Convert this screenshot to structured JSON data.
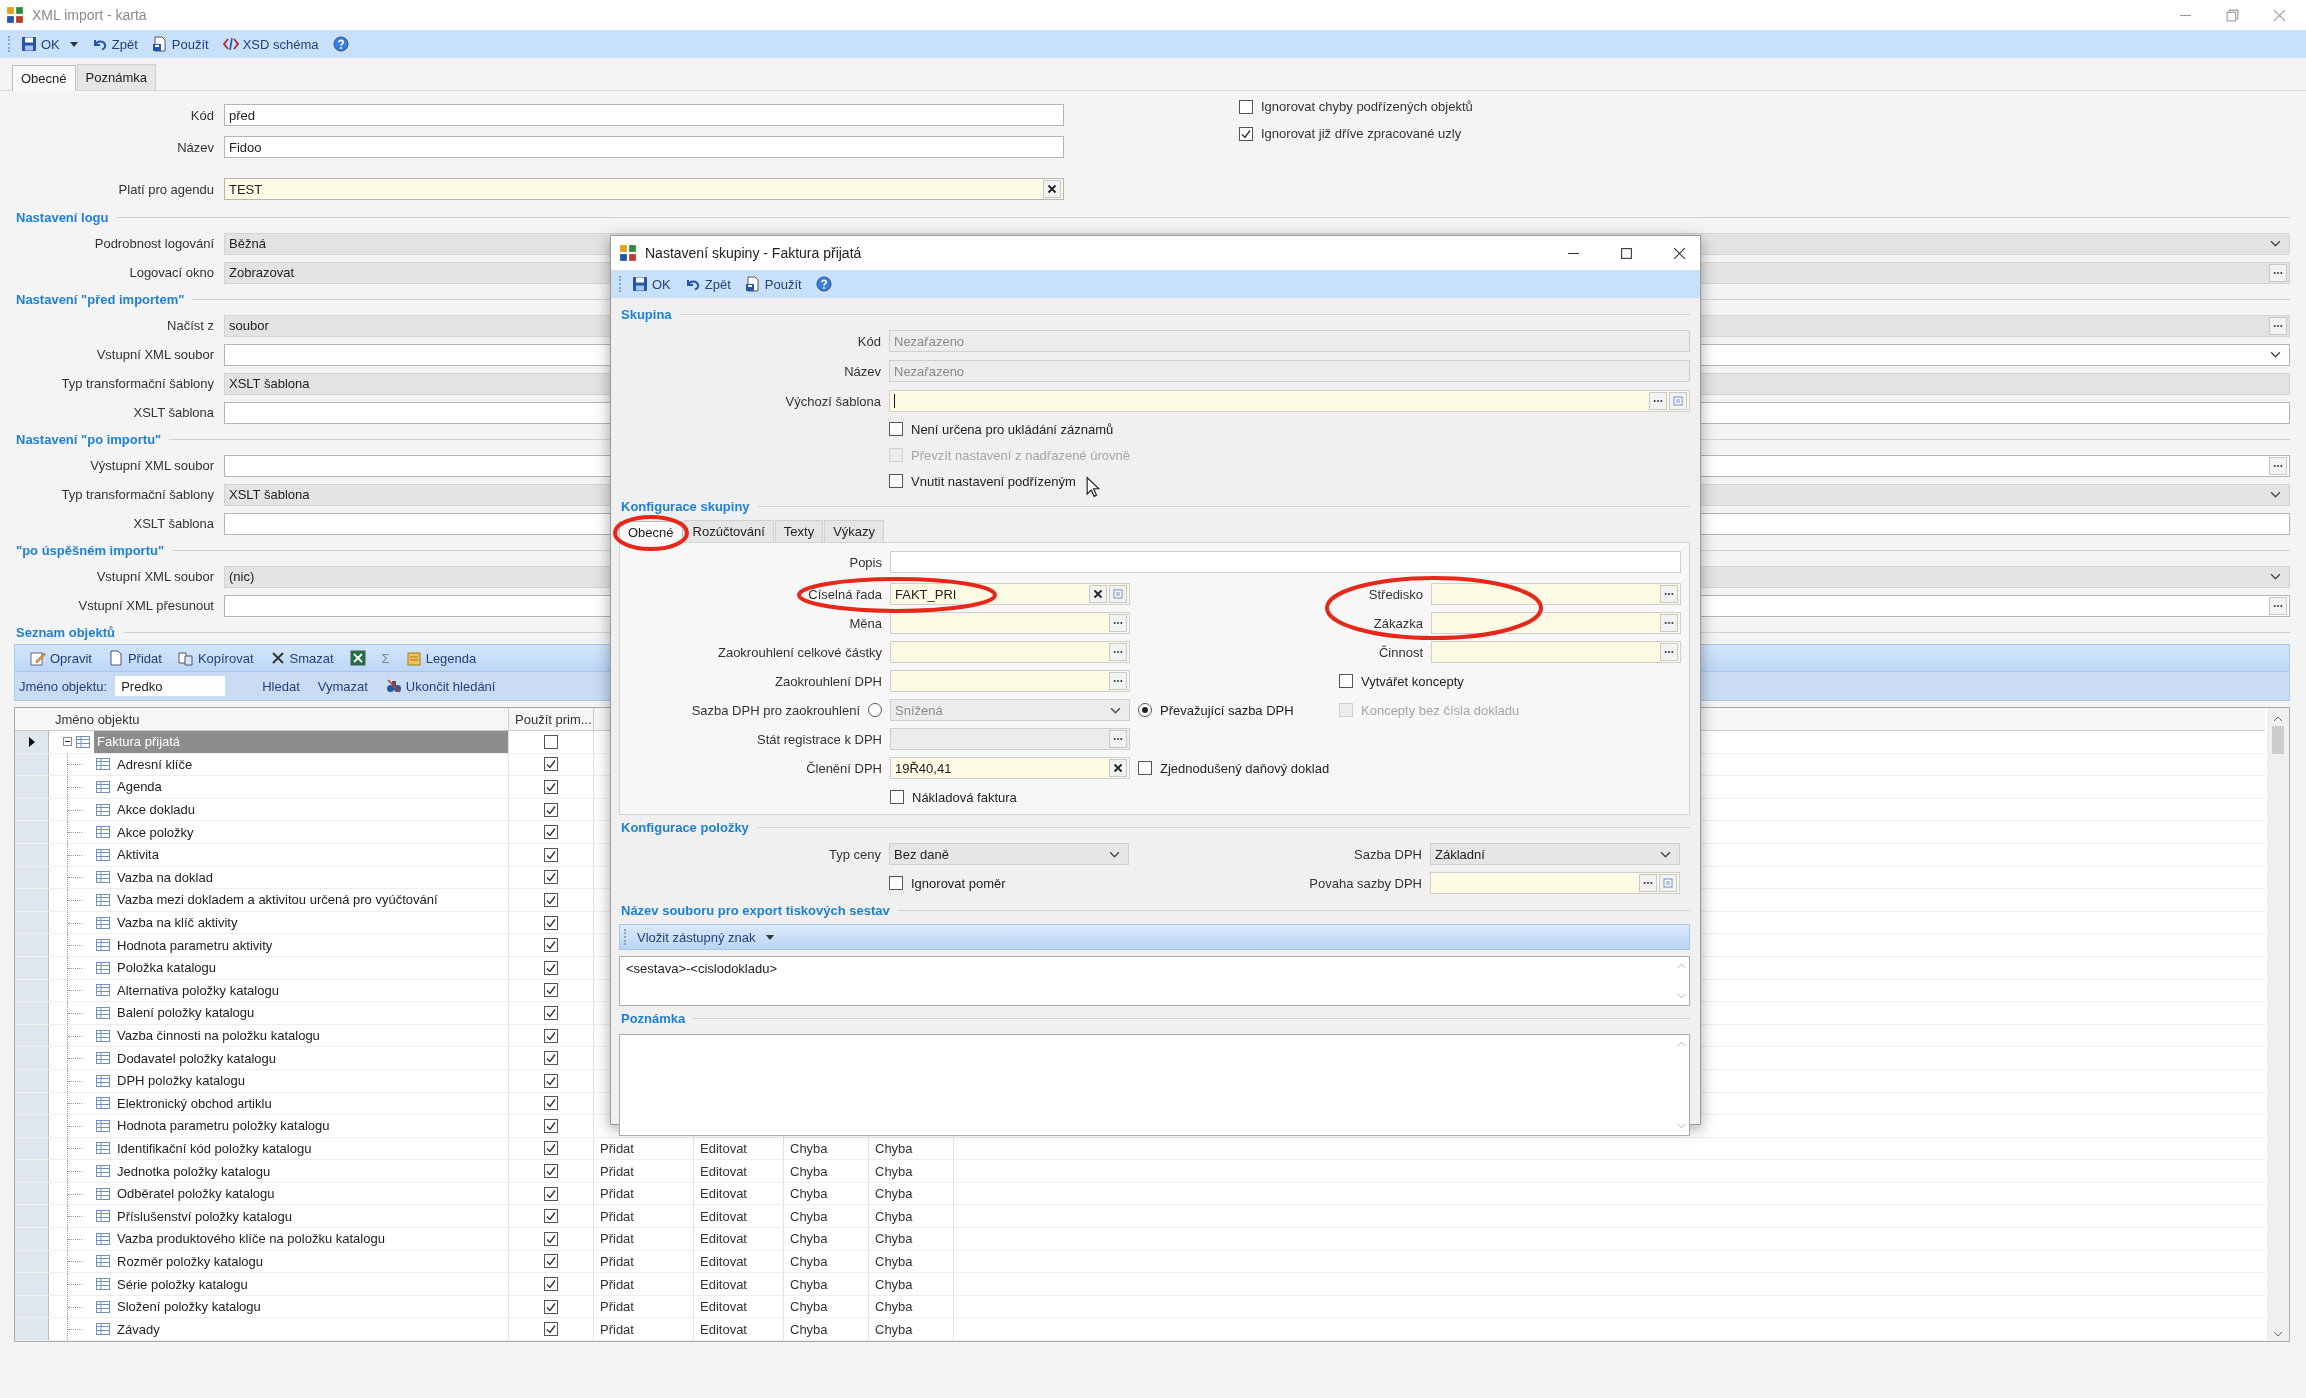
{
  "window": {
    "title": "XML import - karta"
  },
  "toolbar": [
    {
      "kind": "save",
      "label": "OK",
      "menu": true
    },
    {
      "kind": "undo",
      "label": "Zpět"
    },
    {
      "kind": "apply",
      "label": "Použít"
    },
    {
      "kind": "schema",
      "label": "XSD schéma"
    },
    {
      "kind": "help"
    }
  ],
  "tabs": [
    {
      "label": "Obecné",
      "selected": true
    },
    {
      "label": "Poznámka",
      "selected": false
    }
  ],
  "header_fields": [
    {
      "label": "Kód",
      "value": "před",
      "kind": "text"
    },
    {
      "label": "Název",
      "value": "Fidoo",
      "kind": "text"
    },
    {
      "label": "Platí pro agendu",
      "value": "TEST",
      "kind": "lookup"
    }
  ],
  "options": [
    {
      "label": "Ignorovat chyby podřízených objektů",
      "checked": false
    },
    {
      "label": "Ignorovat již dříve zpracované uzly",
      "checked": true
    }
  ],
  "sections": [
    {
      "title": "Nastavení logu",
      "rows": [
        {
          "label": "Podrobnost logování",
          "value": "Běžná",
          "kind": "select",
          "dropdown": true
        },
        {
          "label": "Logovací okno",
          "value": "Zobrazovat",
          "kind": "select",
          "browse": true
        }
      ]
    },
    {
      "title": "Nastavení \"před importem\"",
      "rows": [
        {
          "label": "Načíst z",
          "value": "soubor",
          "kind": "select",
          "browse": true
        },
        {
          "label": "Vstupní XML soubor",
          "kind": "text",
          "dropdown": true
        },
        {
          "label": "Typ transformační šablony",
          "value": "XSLT šablona",
          "kind": "select"
        },
        {
          "label": "XSLT šablona",
          "kind": "text"
        }
      ]
    },
    {
      "title": "Nastavení \"po importu\"",
      "rows": [
        {
          "label": "Výstupní XML soubor",
          "kind": "text",
          "browse": true
        },
        {
          "label": "Typ transformační šablony",
          "value": "XSLT šablona",
          "kind": "select",
          "dropdown": true
        },
        {
          "label": "XSLT šablona",
          "kind": "text"
        }
      ]
    },
    {
      "title": "\"po úspěšném importu\"",
      "rows": [
        {
          "label": "Vstupní XML soubor",
          "value": "(nic)",
          "kind": "select",
          "dropdown": true
        },
        {
          "label": "Vstupní XML přesunout",
          "kind": "text",
          "browse": true
        }
      ]
    }
  ],
  "objects": {
    "title": "Seznam objektů",
    "toolbar": [
      {
        "kind": "edit",
        "label": "Opravit"
      },
      {
        "kind": "new",
        "label": "Přidat"
      },
      {
        "kind": "copy",
        "label": "Kopírovat"
      },
      {
        "kind": "delete",
        "label": "Smazat"
      },
      {
        "kind": "excel"
      },
      {
        "kind": "sum",
        "label": "Σ"
      },
      {
        "kind": "legend",
        "label": "Legenda"
      }
    ],
    "search": {
      "label": "Jméno objektu:",
      "value": "Predko",
      "actions": [
        {
          "label": "Hledat"
        },
        {
          "label": "Vymazat"
        },
        {
          "label": "Ukončit hledání",
          "icon": true
        }
      ]
    },
    "table": {
      "columns": [
        "Jméno objektu",
        "Použít prim..."
      ],
      "rows": [
        {
          "name": "Faktura přijatá",
          "used": false,
          "selected": true,
          "expanded": true,
          "children": [
            {
              "name": "Adresní klíče",
              "used": true,
              "selected": false
            },
            {
              "name": "Agenda",
              "used": true,
              "selected": false
            },
            {
              "name": "Akce dokladu",
              "used": true,
              "selected": false
            },
            {
              "name": "Akce položky",
              "used": true,
              "selected": false
            },
            {
              "name": "Aktivita",
              "used": true,
              "selected": false
            },
            {
              "name": "Vazba na doklad",
              "used": true,
              "selected": false
            },
            {
              "name": "Vazba mezi dokladem a aktivitou určená pro vyúčtování",
              "used": true,
              "selected": false
            },
            {
              "name": "Vazba na klíč aktivity",
              "used": true,
              "selected": false
            },
            {
              "name": "Hodnota parametru aktivity",
              "used": true,
              "selected": false
            },
            {
              "name": "Položka katalogu",
              "used": true,
              "selected": false
            },
            {
              "name": "Alternativa položky katalogu",
              "used": true,
              "selected": false
            },
            {
              "name": "Balení položky katalogu",
              "used": true,
              "selected": false
            },
            {
              "name": "Vazba činnosti na položku katalogu",
              "used": true,
              "selected": false
            },
            {
              "name": "Dodavatel položky katalogu",
              "used": true,
              "selected": false
            },
            {
              "name": "DPH položky katalogu",
              "used": true,
              "selected": false
            },
            {
              "name": "Elektronický obchod artiklu",
              "used": true,
              "selected": false
            },
            {
              "name": "Hodnota parametru položky katalogu",
              "used": true,
              "selected": false
            },
            {
              "name": "Identifikační kód položky katalogu",
              "used": true,
              "selected": false,
              "cells": [
                "Přidat",
                "Editovat",
                "Chyba",
                "Chyba"
              ]
            },
            {
              "name": "Jednotka položky katalogu",
              "used": true,
              "selected": false,
              "cells": [
                "Přidat",
                "Editovat",
                "Chyba",
                "Chyba"
              ]
            },
            {
              "name": "Odběratel položky katalogu",
              "used": true,
              "selected": false,
              "cells": [
                "Přidat",
                "Editovat",
                "Chyba",
                "Chyba"
              ]
            },
            {
              "name": "Příslušenství položky katalogu",
              "used": true,
              "selected": false,
              "cells": [
                "Přidat",
                "Editovat",
                "Chyba",
                "Chyba"
              ]
            },
            {
              "name": "Vazba produktového klíče na položku katalogu",
              "used": true,
              "selected": false,
              "cells": [
                "Přidat",
                "Editovat",
                "Chyba",
                "Chyba"
              ]
            },
            {
              "name": "Rozměr položky katalogu",
              "used": true,
              "selected": false,
              "cells": [
                "Přidat",
                "Editovat",
                "Chyba",
                "Chyba"
              ]
            },
            {
              "name": "Série položky katalogu",
              "used": true,
              "selected": false,
              "cells": [
                "Přidat",
                "Editovat",
                "Chyba",
                "Chyba"
              ]
            },
            {
              "name": "Složení položky katalogu",
              "used": true,
              "selected": false,
              "cells": [
                "Přidat",
                "Editovat",
                "Chyba",
                "Chyba"
              ]
            },
            {
              "name": "Závady",
              "used": true,
              "selected": false,
              "cells": [
                "Přidat",
                "Editovat",
                "Chyba",
                "Chyba"
              ]
            }
          ]
        }
      ]
    }
  },
  "dialog": {
    "title": "Nastavení skupiny - Faktura přijatá",
    "toolbar": [
      {
        "kind": "save",
        "label": "OK"
      },
      {
        "kind": "undo",
        "label": "Zpět"
      },
      {
        "kind": "apply",
        "label": "Použít"
      },
      {
        "kind": "help"
      }
    ],
    "group": {
      "title": "Skupina",
      "fields": [
        {
          "label": "Kód",
          "value": "Nezařazeno",
          "kind": "disabled"
        },
        {
          "label": "Název",
          "value": "Nezařazeno",
          "kind": "disabled"
        },
        {
          "label": "Výchozí šablona",
          "kind": "lookup",
          "focused": true
        }
      ],
      "checks": [
        {
          "label": "Není určena pro ukládání záznamů",
          "checked": false,
          "disabled": false
        },
        {
          "label": "Převzít nastavení z nadřazené úrovně",
          "checked": false,
          "disabled": true
        },
        {
          "label": "Vnutit nastavení podřízeným",
          "checked": false,
          "disabled": false
        }
      ]
    },
    "config": {
      "title": "Konfigurace skupiny",
      "tabs": [
        {
          "label": "Obecné",
          "selected": true
        },
        {
          "label": "Rozúčtování",
          "selected": false
        },
        {
          "label": "Texty",
          "selected": false
        },
        {
          "label": "Výkazy",
          "selected": false
        }
      ],
      "description": {
        "label": "Popis"
      },
      "left": [
        {
          "kind": "lookup",
          "label": "Číselná řada",
          "value": "FAKT_PRI",
          "clear": true,
          "detail": true
        },
        {
          "kind": "lookup",
          "label": "Měna",
          "browse": true
        },
        {
          "kind": "lookup",
          "label": "Zaokrouhlení celkové částky",
          "browse": true
        },
        {
          "kind": "lookup",
          "label": "Zaokrouhlení DPH",
          "browse": true
        },
        {
          "kind": "choice",
          "label": "Sazba DPH pro zaokrouhlení",
          "selected": false,
          "value": "Snížená",
          "alt_label": "Převažující sazba DPH",
          "alt_selected": true
        },
        {
          "kind": "disabled",
          "label": "Stát registrace k DPH",
          "browse": true
        },
        {
          "kind": "lookup",
          "label": "Členění DPH",
          "value": "19Ř40,41",
          "clear": true,
          "check": {
            "label": "Zjednodušený daňový doklad",
            "checked": false
          }
        },
        {
          "kind": "check",
          "label": "Nákladová faktura",
          "checked": false,
          "disabled": false
        }
      ],
      "right": [
        {
          "kind": "lookup",
          "label": "Středisko",
          "browse": true
        },
        {
          "kind": "lookup",
          "label": "Zákazka",
          "browse": true
        },
        {
          "kind": "lookup",
          "label": "Činnost",
          "browse": true
        },
        {
          "kind": "check",
          "label": "Vytvářet koncepty",
          "checked": false,
          "disabled": false
        },
        {
          "kind": "check",
          "label": "Koncepty bez čísla dokladu",
          "checked": false,
          "disabled": true
        }
      ]
    },
    "items": {
      "title": "Konfigurace položky",
      "left": [
        {
          "kind": "select",
          "label": "Typ ceny",
          "value": "Bez daně"
        },
        {
          "kind": "check",
          "label": "Ignorovat poměr",
          "checked": false,
          "disabled": false
        }
      ],
      "right": [
        {
          "kind": "select",
          "label": "Sazba DPH",
          "value": "Základní"
        },
        {
          "kind": "lookup",
          "label": "Povaha sazby DPH",
          "browse": true,
          "detail": true
        }
      ]
    },
    "export": {
      "title": "Název souboru pro export tiskových sestav",
      "insert_label": "Vložit zástupný znak",
      "value": "<sestava>-<cislodokladu>"
    },
    "note": {
      "title": "Poznámka"
    }
  }
}
